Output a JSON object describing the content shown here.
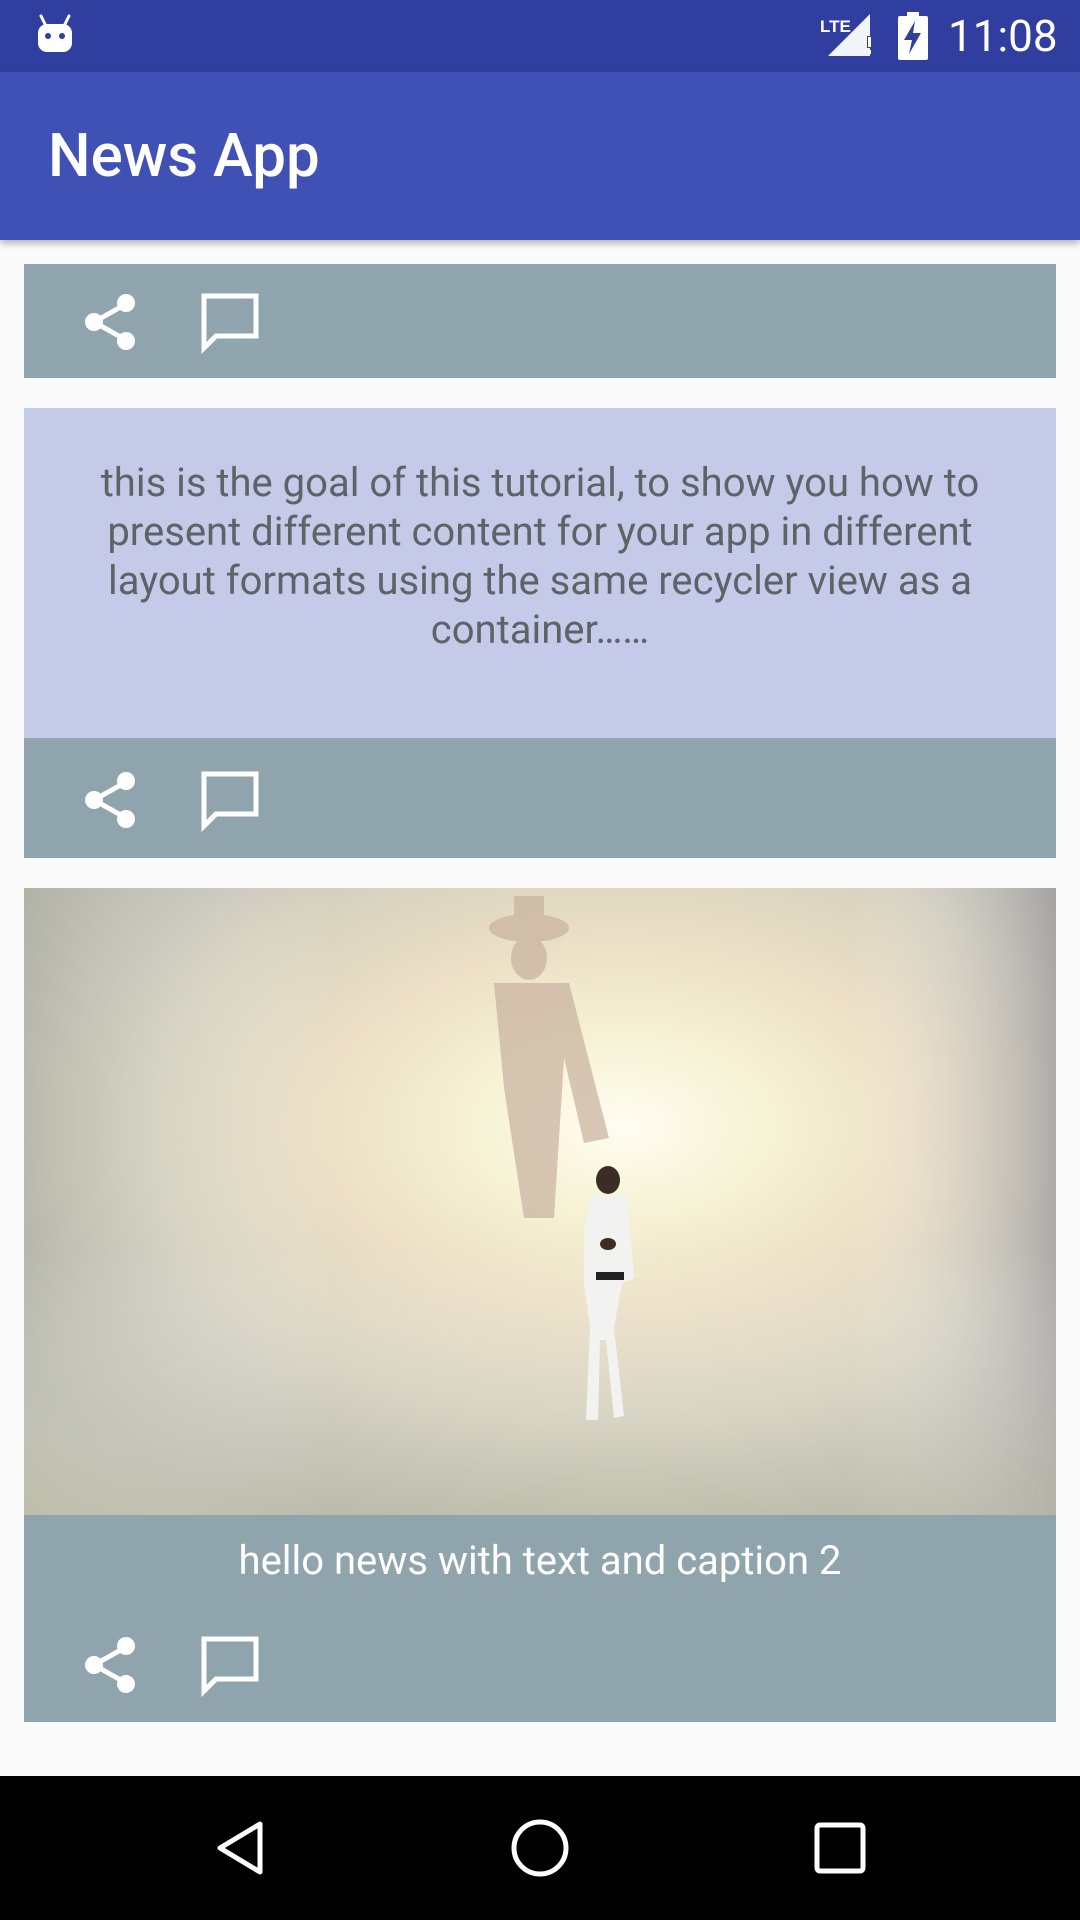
{
  "status_bar": {
    "time": "11:08",
    "icons": [
      "android-icon",
      "lte-signal-icon",
      "battery-charging-icon"
    ]
  },
  "app_bar": {
    "title": "News App"
  },
  "feed": {
    "cards": [
      {
        "type": "actions-only",
        "actions": [
          "share-icon",
          "comment-icon"
        ]
      },
      {
        "type": "text",
        "body": "this is the goal of this tutorial, to show you how to present different content for your app in different layout formats using the same recycler view as a container……",
        "actions": [
          "share-icon",
          "comment-icon"
        ]
      },
      {
        "type": "image-caption",
        "image": "man-walking-with-shadow-image",
        "caption": "hello news with text and caption 2",
        "actions": [
          "share-icon",
          "comment-icon"
        ]
      }
    ]
  },
  "nav_bar": {
    "buttons": [
      "back-icon",
      "home-icon",
      "recents-icon"
    ]
  },
  "colors": {
    "status_bar": "#303f9f",
    "app_bar": "#3f51b5",
    "action_bar": "#90a4ae",
    "text_panel": "#c5cae9",
    "background": "#fafafa"
  }
}
